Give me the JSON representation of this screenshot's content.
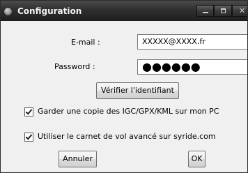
{
  "window": {
    "title": "Configuration",
    "controls": {
      "minimize": "minimize-icon",
      "maximize": "maximize-icon",
      "close": "close-icon"
    }
  },
  "form": {
    "email_label": "E-mail :",
    "email_value": "XXXXX@XXXX.fr",
    "password_label": "Password :",
    "password_value": "●●●●●●",
    "verify_button": "Vérifier l'identifiant"
  },
  "options": {
    "keep_copy_label": "Garder une copie des IGC/GPX/KML sur mon PC",
    "keep_copy_checked": true,
    "advanced_logbook_label": "Utiliser le carnet de vol avancé sur syride.com",
    "advanced_logbook_checked": true
  },
  "actions": {
    "cancel_label": "Annuler",
    "ok_label": "OK"
  }
}
